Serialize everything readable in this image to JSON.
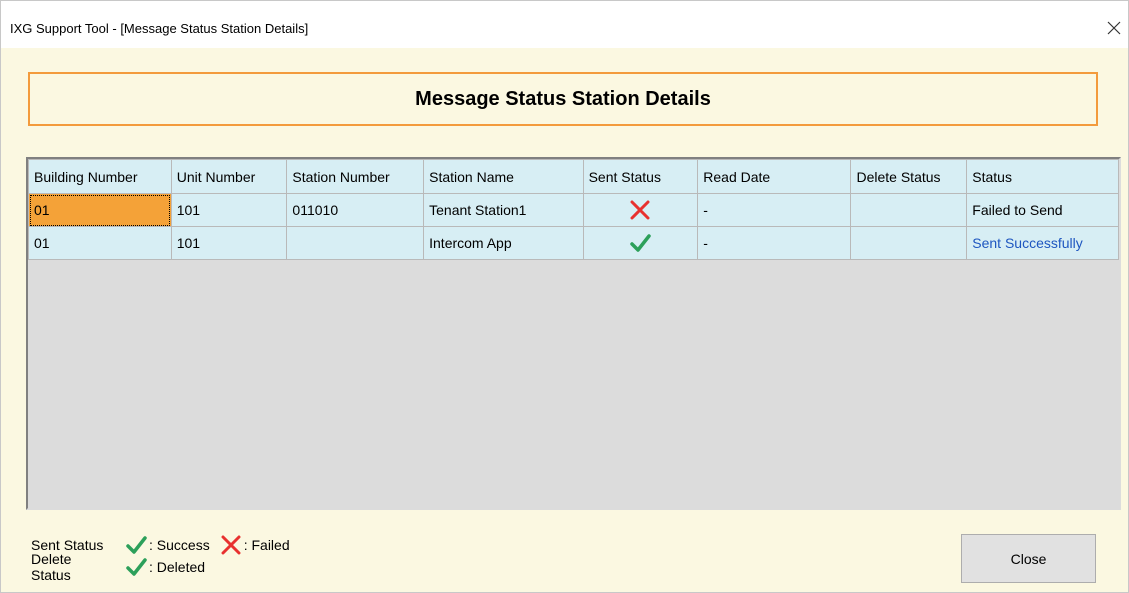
{
  "window": {
    "title": "IXG Support Tool - [Message Status Station Details]"
  },
  "header": {
    "title": "Message Status Station Details"
  },
  "table": {
    "columns": [
      "Building Number",
      "Unit Number",
      "Station Number",
      "Station Name",
      "Sent Status",
      "Read Date",
      "Delete Status",
      "Status"
    ],
    "rows": [
      {
        "building_number": "01",
        "unit_number": "101",
        "station_number": "011010",
        "station_name": "Tenant Station1",
        "sent_status_icon": "failed-x-icon",
        "read_date": "-",
        "delete_status": "",
        "status": "Failed to Send"
      },
      {
        "building_number": "01",
        "unit_number": "101",
        "station_number": "",
        "station_name": "Intercom App",
        "sent_status_icon": "success-check-icon",
        "read_date": "-",
        "delete_status": "",
        "status": "Sent Successfully"
      }
    ]
  },
  "legend": {
    "sent_status_label": "Sent Status",
    "success_label": ": Success",
    "failed_label": ": Failed",
    "delete_status_label": "Delete Status",
    "deleted_label": ": Deleted"
  },
  "buttons": {
    "close": "Close"
  },
  "colors": {
    "success": "#2ca05a",
    "failed": "#e8312f",
    "accent_border": "#f39b3c",
    "selection": "#f4a238",
    "row_bg": "#d7eef4",
    "link_text": "#1e56c0"
  }
}
